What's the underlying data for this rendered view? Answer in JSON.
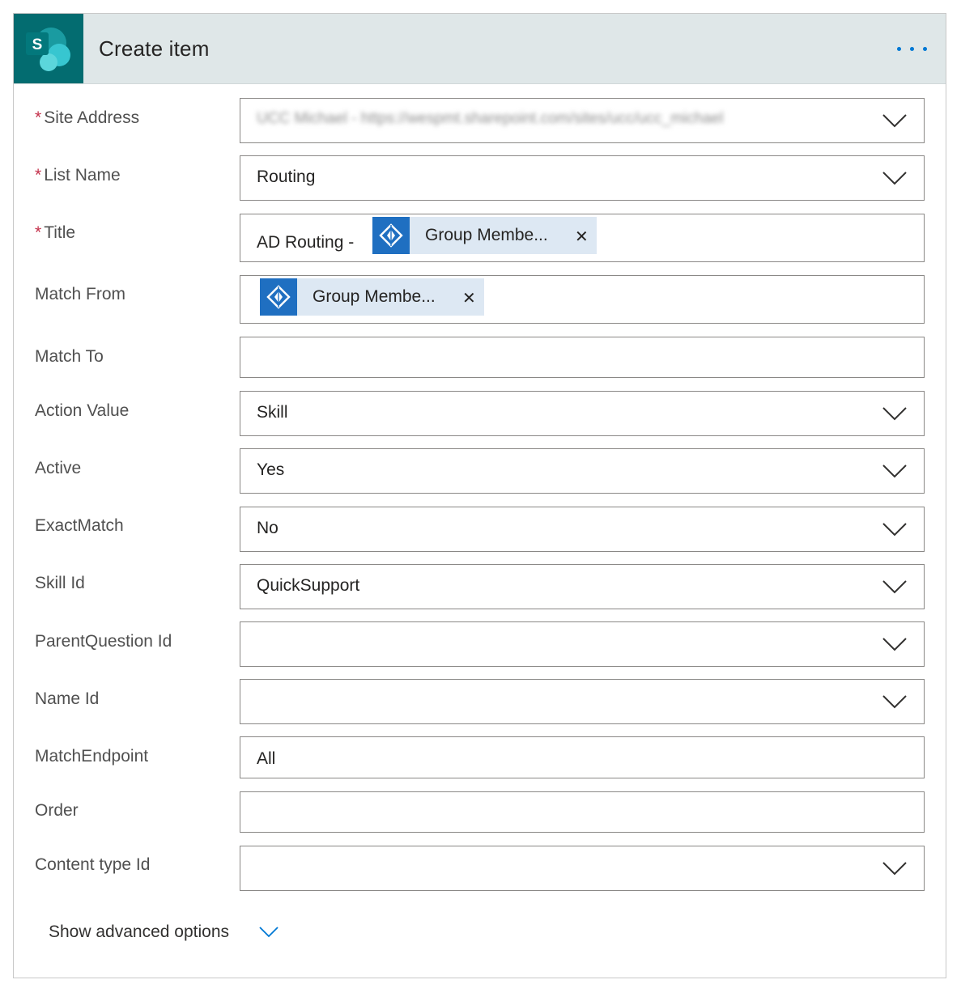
{
  "header": {
    "title": "Create item",
    "more_icon": "ellipsis-icon",
    "app_icon": "sharepoint-icon"
  },
  "fields": {
    "site_address": {
      "label": "Site Address",
      "required": true,
      "value": "UCC Michael - https://wespmt.sharepoint.com/sites/ucc/ucc_michael"
    },
    "list_name": {
      "label": "List Name",
      "required": true,
      "value": "Routing"
    },
    "title": {
      "label": "Title",
      "required": true,
      "value": "AD Routing -",
      "token": "Group Membe..."
    },
    "match_from": {
      "label": "Match From",
      "token": "Group Membe..."
    },
    "match_to": {
      "label": "Match To",
      "value": ""
    },
    "action_value": {
      "label": "Action Value",
      "value": "Skill"
    },
    "active": {
      "label": "Active",
      "value": "Yes"
    },
    "exact_match": {
      "label": "ExactMatch",
      "value": "No"
    },
    "skill_id": {
      "label": "Skill Id",
      "value": "QuickSupport"
    },
    "parent_question_id": {
      "label": "ParentQuestion Id",
      "value": ""
    },
    "name_id": {
      "label": "Name Id",
      "value": ""
    },
    "match_endpoint": {
      "label": "MatchEndpoint",
      "value": "All"
    },
    "order": {
      "label": "Order",
      "value": ""
    },
    "content_type_id": {
      "label": "Content type Id",
      "value": ""
    }
  },
  "footer": {
    "advanced_label": "Show advanced options"
  },
  "colors": {
    "header_bg": "#dfe7e8",
    "sharepoint_teal": "#036c70",
    "accent": "#0078d4",
    "required": "#c4314b",
    "token_bg": "#dde8f3",
    "token_icon_bg": "#1f6fc1"
  }
}
